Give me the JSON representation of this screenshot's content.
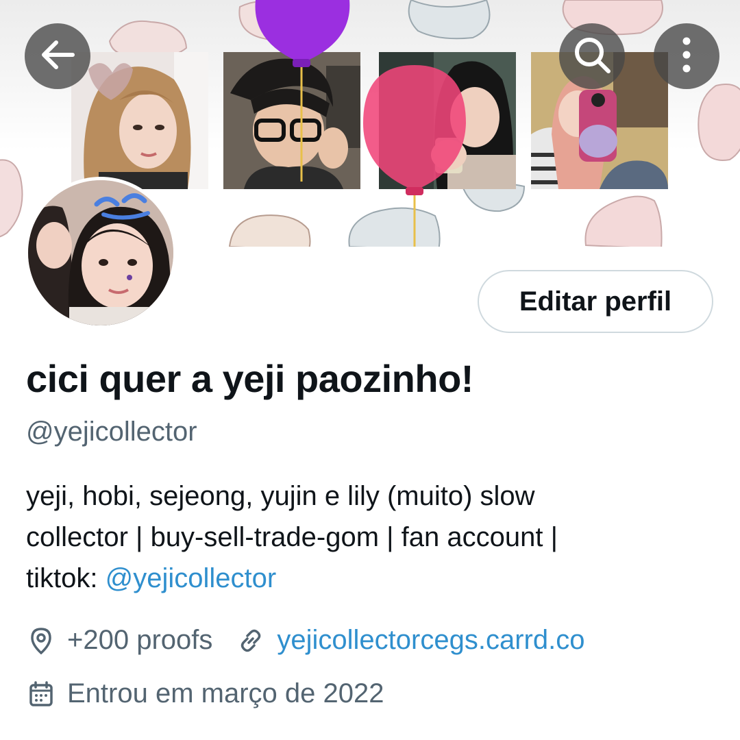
{
  "header": {
    "back_icon": "arrow-left-icon",
    "search_icon": "search-icon",
    "more_icon": "more-vertical-icon"
  },
  "profile": {
    "display_name": "cici quer a yeji paozinho!",
    "handle": "@yejicollector",
    "edit_button": "Editar perfil",
    "bio": {
      "line1": "yeji, hobi, sejeong, yujin e lily (muito) slow",
      "line2": "collector | buy-sell-trade-gom | fan account |",
      "line3_prefix": "tiktok: ",
      "line3_link": "@yejicollector"
    },
    "location": "+200 proofs",
    "website": "yejicollectorcegs.carrd.co",
    "joined": "Entrou em março de 2022"
  },
  "colors": {
    "link": "#2f8fce",
    "secondary_text": "#536471",
    "primary_text": "#0f1419",
    "balloon_purple": "#9b2fe0",
    "balloon_pink": "#f0457a"
  }
}
